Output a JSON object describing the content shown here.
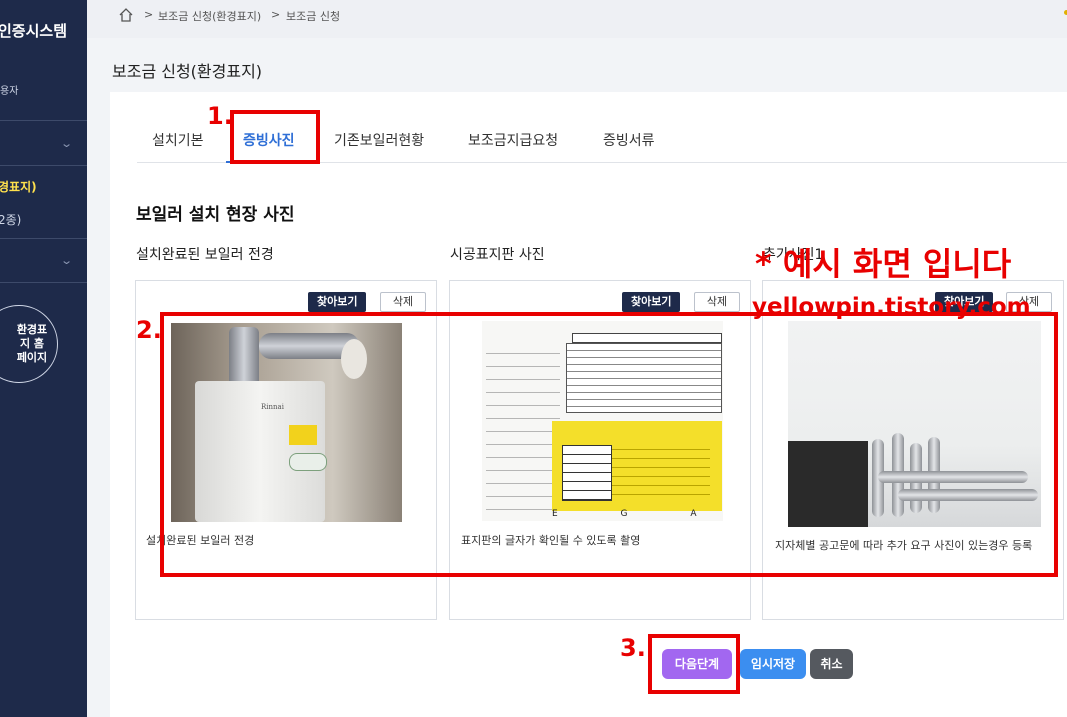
{
  "sidebar": {
    "title": "인증시스템",
    "user_label": "용자",
    "active_item": "경표지)",
    "sub_item": "2종)",
    "home_link": "환경표지 홈페이지"
  },
  "breadcrumb": {
    "items": [
      "보조금 신청(환경표지)",
      "보조금 신청"
    ],
    "separator": ">"
  },
  "page_title": "보조금 신청(환경표지)",
  "tabs": [
    {
      "label": "설치기본",
      "active": false
    },
    {
      "label": "증빙사진",
      "active": true
    },
    {
      "label": "기존보일러현황",
      "active": false
    },
    {
      "label": "보조금지급요청",
      "active": false
    },
    {
      "label": "증빙서류",
      "active": false
    }
  ],
  "section_title": "보일러 설치 현장 사진",
  "photo_cards": [
    {
      "label": "설치완료된 보일러 전경",
      "find_button": "찾아보기",
      "delete_button": "삭제",
      "caption": "설치완료된 보일러 전경",
      "photo_text": "Rinnai"
    },
    {
      "label": "시공표지판 사진",
      "find_button": "찾아보기",
      "delete_button": "삭제",
      "caption": "표지판의 글자가 확인될 수 있도록 촬영",
      "photo_text": "E G A L"
    },
    {
      "label": "추가사진1",
      "find_button": "찾아보기",
      "delete_button": "삭제",
      "caption": "지자체별 공고문에 따라 추가 요구 사진이 있는경우 등록"
    }
  ],
  "actions": {
    "next": "다음단계",
    "temp_save": "임시저장",
    "cancel": "취소"
  },
  "annotations": {
    "step1": "1.",
    "step2": "2.",
    "step3": "3.",
    "watermark_line1": "* 예시 화면 입니다",
    "watermark_line2": "yellowpin.tistory.com",
    "color": "#e80000"
  },
  "colors": {
    "sidebar_bg": "#1e2a4a",
    "active_tab": "#2f6fd6",
    "sidebar_active": "#ffe14d",
    "next_button": "#a267f0",
    "save_button": "#3b8ef0",
    "cancel_button": "#55595f"
  }
}
